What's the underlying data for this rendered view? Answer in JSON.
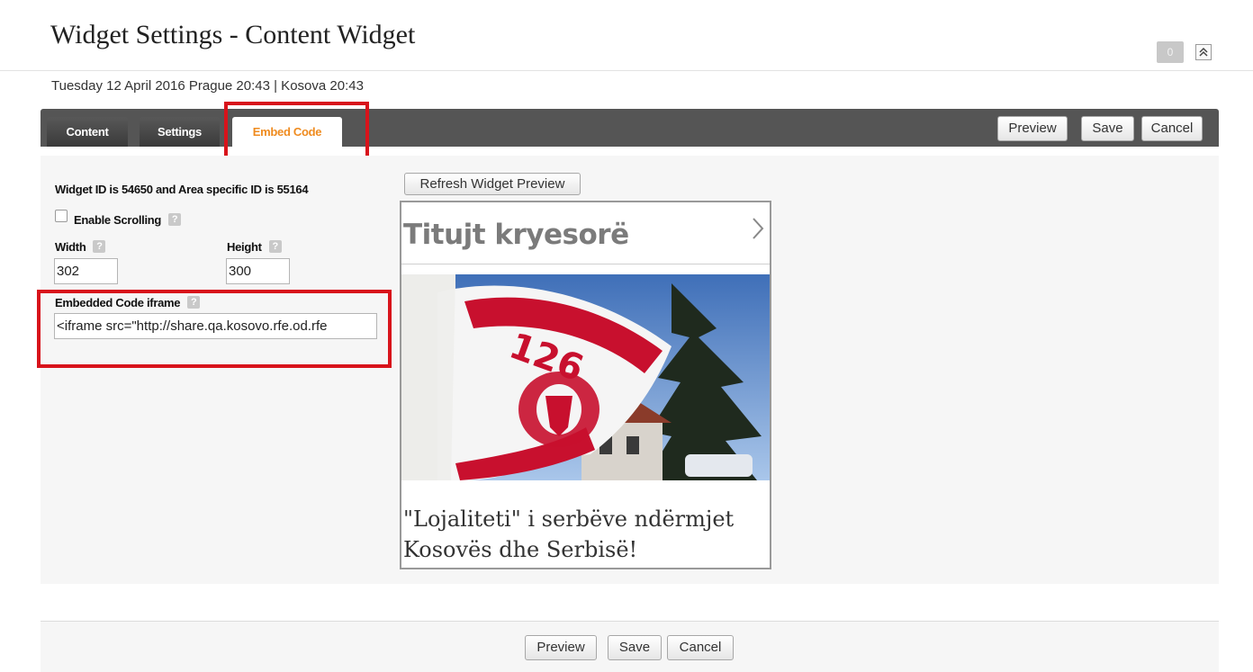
{
  "header": {
    "title": "Widget Settings - Content Widget",
    "counter": "0",
    "date_line": "Tuesday 12 April 2016 Prague 20:43 | Kosova 20:43"
  },
  "tabs": [
    {
      "label": "Content"
    },
    {
      "label": "Settings"
    },
    {
      "label": "Embed Code",
      "active": true
    }
  ],
  "toolbar": {
    "preview_label": "Preview",
    "save_label": "Save",
    "cancel_label": "Cancel"
  },
  "form": {
    "widget_id_text": "Widget ID is 54650 and Area specific ID is 55164",
    "enable_scrolling_label": "Enable Scrolling",
    "enable_scrolling_checked": false,
    "width_label": "Width",
    "width_value": "302",
    "height_label": "Height",
    "height_value": "300",
    "embed_label": "Embedded Code iframe",
    "embed_value": "<iframe src=\"http://share.qa.kosovo.rfe.od.rfe"
  },
  "preview": {
    "refresh_label": "Refresh Widget Preview",
    "widget_title": "Titujt kryesorë",
    "caption": "\"Lojaliteti\" i serbëve ndërmjet Kosovës dhe Serbisë!",
    "flag_number": "126"
  },
  "footer": {
    "preview_label": "Preview",
    "save_label": "Save",
    "cancel_label": "Cancel"
  },
  "colors": {
    "tabbar": "#555555",
    "active_tab_text": "#ef8b1f",
    "highlight": "#d8131b",
    "panel": "#f6f6f6"
  }
}
